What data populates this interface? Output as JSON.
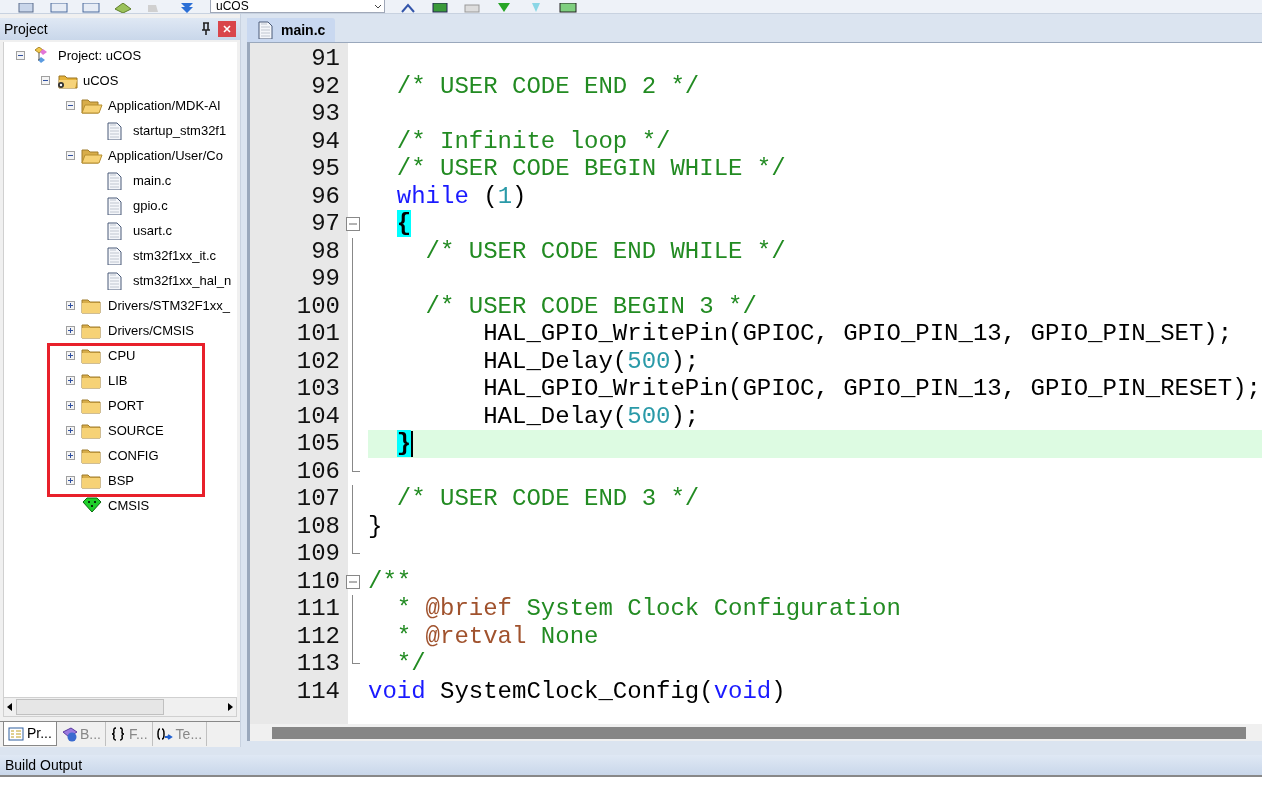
{
  "toolbar": {
    "target": "uCOS"
  },
  "project_panel": {
    "title": "Project",
    "tree": [
      {
        "label": "Project: uCOS",
        "kind": "project",
        "expanded": true,
        "children": [
          {
            "label": "uCOS",
            "kind": "target",
            "expanded": true,
            "children": [
              {
                "label": "Application/MDK-AI",
                "kind": "folder",
                "expanded": true,
                "children": [
                  {
                    "label": "startup_stm32f1",
                    "kind": "file"
                  }
                ]
              },
              {
                "label": "Application/User/Co",
                "kind": "folder",
                "expanded": true,
                "children": [
                  {
                    "label": "main.c",
                    "kind": "file"
                  },
                  {
                    "label": "gpio.c",
                    "kind": "file"
                  },
                  {
                    "label": "usart.c",
                    "kind": "file"
                  },
                  {
                    "label": "stm32f1xx_it.c",
                    "kind": "file"
                  },
                  {
                    "label": "stm32f1xx_hal_n",
                    "kind": "file"
                  }
                ]
              },
              {
                "label": "Drivers/STM32F1xx_",
                "kind": "folder",
                "expanded": false
              },
              {
                "label": "Drivers/CMSIS",
                "kind": "folder",
                "expanded": false
              },
              {
                "label": "CPU",
                "kind": "folder",
                "expanded": false
              },
              {
                "label": "LIB",
                "kind": "folder",
                "expanded": false
              },
              {
                "label": "PORT",
                "kind": "folder",
                "expanded": false
              },
              {
                "label": "SOURCE",
                "kind": "folder",
                "expanded": false
              },
              {
                "label": "CONFIG",
                "kind": "folder",
                "expanded": false
              },
              {
                "label": "BSP",
                "kind": "folder",
                "expanded": false
              },
              {
                "label": "CMSIS",
                "kind": "component"
              }
            ]
          }
        ]
      }
    ],
    "tabs": [
      {
        "label": "Pr...",
        "kind": "project",
        "selected": true
      },
      {
        "label": "B...",
        "kind": "books",
        "selected": false
      },
      {
        "label": "F...",
        "kind": "braces",
        "selected": false
      },
      {
        "label": "Te...",
        "kind": "template",
        "selected": false
      }
    ]
  },
  "editor": {
    "tabs": [
      {
        "label": "main.c",
        "selected": true
      }
    ],
    "lines": [
      {
        "number": "91"
      },
      {
        "number": "92",
        "tokens": [
          {
            "kind": "comment",
            "text": "  /* USER CODE END 2 */"
          }
        ]
      },
      {
        "number": "93"
      },
      {
        "number": "94",
        "tokens": [
          {
            "kind": "comment",
            "text": "  /* Infinite loop */"
          }
        ]
      },
      {
        "number": "95",
        "tokens": [
          {
            "kind": "comment",
            "text": "  /* USER CODE BEGIN WHILE */"
          }
        ]
      },
      {
        "number": "96",
        "tokens": [
          {
            "kind": "keyword",
            "text": "  while"
          },
          {
            "kind": "text",
            "text": " ("
          },
          {
            "kind": "number",
            "text": "1"
          },
          {
            "kind": "text",
            "text": ")"
          }
        ]
      },
      {
        "number": "97",
        "fold_start": true,
        "tokens": [
          {
            "kind": "brace_match",
            "text": "{"
          }
        ]
      },
      {
        "number": "98",
        "fold_line": true,
        "tokens": [
          {
            "kind": "comment",
            "text": "    /* USER CODE END WHILE */"
          }
        ]
      },
      {
        "number": "99",
        "fold_line": true
      },
      {
        "number": "100",
        "fold_line": true,
        "tokens": [
          {
            "kind": "comment",
            "text": "    /* USER CODE BEGIN 3 */"
          }
        ]
      },
      {
        "number": "101",
        "fold_line": true,
        "tokens": [
          {
            "kind": "text",
            "text": "        HAL_GPIO_WritePin(GPIOC, GPIO_PIN_13, GPIO_PIN_SET);"
          }
        ]
      },
      {
        "number": "102",
        "fold_line": true,
        "tokens": [
          {
            "kind": "text",
            "text": "        HAL_Delay("
          },
          {
            "kind": "number",
            "text": "500"
          },
          {
            "kind": "text",
            "text": ");"
          }
        ]
      },
      {
        "number": "103",
        "fold_line": true,
        "tokens": [
          {
            "kind": "text",
            "text": "        HAL_GPIO_WritePin(GPIOC, GPIO_PIN_13, GPIO_PIN_RESET);"
          }
        ]
      },
      {
        "number": "104",
        "fold_line": true,
        "tokens": [
          {
            "kind": "text",
            "text": "        HAL_Delay("
          },
          {
            "kind": "number",
            "text": "500"
          },
          {
            "kind": "text",
            "text": ");"
          }
        ]
      },
      {
        "number": "105",
        "fold_line": true,
        "current": true,
        "tokens": [
          {
            "kind": "brace_match",
            "text": "}"
          }
        ]
      },
      {
        "number": "106",
        "fold_end": true
      },
      {
        "number": "107",
        "fold_line": true,
        "tokens": [
          {
            "kind": "comment",
            "text": "  /* USER CODE END 3 */"
          }
        ]
      },
      {
        "number": "108",
        "fold_line": true,
        "tokens": [
          {
            "kind": "text",
            "text": "}"
          }
        ]
      },
      {
        "number": "109",
        "fold_end": true
      },
      {
        "number": "110",
        "fold_start": true,
        "tokens": [
          {
            "kind": "comment",
            "text": "/**"
          }
        ]
      },
      {
        "number": "111",
        "fold_line": true,
        "tokens": [
          {
            "kind": "comment",
            "text": "  * "
          },
          {
            "kind": "doctag",
            "text": "@brief"
          },
          {
            "kind": "comment",
            "text": " System Clock Configuration"
          }
        ]
      },
      {
        "number": "112",
        "fold_line": true,
        "tokens": [
          {
            "kind": "comment",
            "text": "  * "
          },
          {
            "kind": "doctag",
            "text": "@retval"
          },
          {
            "kind": "comment",
            "text": " None"
          }
        ]
      },
      {
        "number": "113",
        "fold_end": true,
        "tokens": [
          {
            "kind": "comment",
            "text": "  */"
          }
        ]
      },
      {
        "number": "114",
        "tokens": [
          {
            "kind": "keyword",
            "text": "void"
          },
          {
            "kind": "text",
            "text": " SystemClock_Config("
          },
          {
            "kind": "keyword",
            "text": "void"
          },
          {
            "kind": "text",
            "text": ")"
          }
        ]
      }
    ]
  },
  "build_output": {
    "title": "Build Output"
  }
}
